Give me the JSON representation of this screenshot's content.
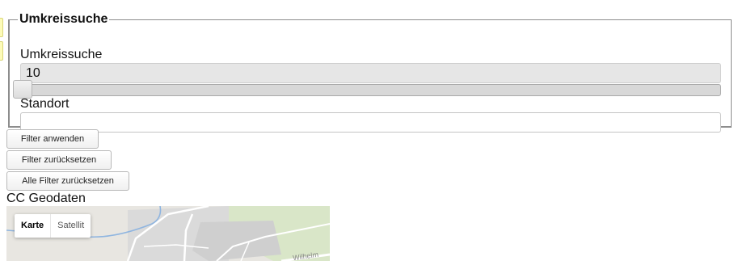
{
  "filter": {
    "legend": "Umkreissuche",
    "radius_label": "Umkreissuche",
    "radius_value": "10",
    "slider_fraction": 0.0,
    "location_label": "Standort",
    "location_value": ""
  },
  "buttons": {
    "apply": "Filter anwenden",
    "reset": "Filter zurücksetzen",
    "reset_all": "Alle Filter zurücksetzen"
  },
  "geodata": {
    "title": "CC Geodaten",
    "map_type_map": "Karte",
    "map_type_satellite": "Satellit",
    "street_label": "Wilhelm"
  }
}
